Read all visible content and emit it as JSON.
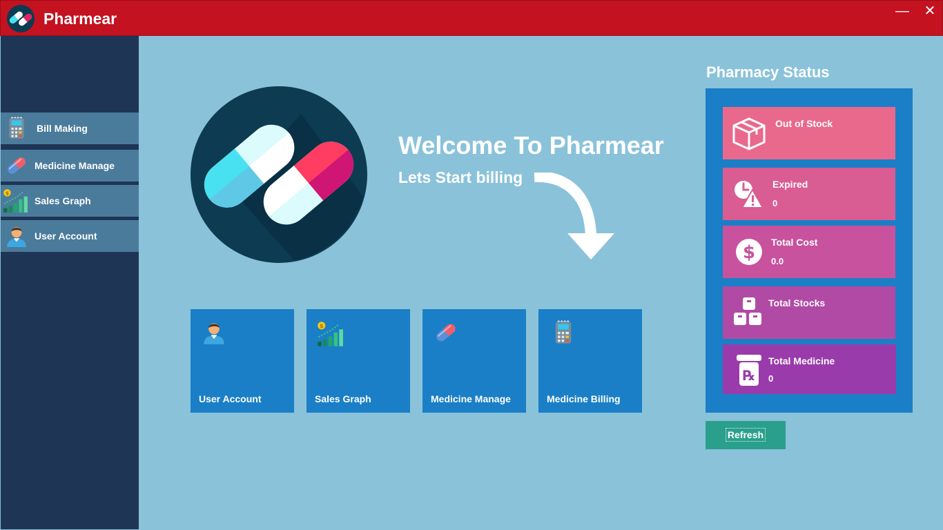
{
  "window": {
    "title": "Pharmear",
    "minimize_glyph": "—",
    "close_glyph": "✕"
  },
  "sidebar": {
    "items": [
      {
        "label": "Bill Making",
        "icon": "calculator-icon"
      },
      {
        "label": "Medicine Manage",
        "icon": "pill-icon"
      },
      {
        "label": "Sales Graph",
        "icon": "sales-graph-icon"
      },
      {
        "label": "User Account",
        "icon": "user-icon"
      }
    ]
  },
  "hero": {
    "title": "Welcome To Pharmear",
    "subtitle": "Lets Start billing"
  },
  "tiles": [
    {
      "label": "User Account",
      "icon": "user-icon"
    },
    {
      "label": "Sales Graph",
      "icon": "sales-graph-icon"
    },
    {
      "label": "Medicine Manage",
      "icon": "pill-icon"
    },
    {
      "label": "Medicine Billing",
      "icon": "calculator-icon"
    }
  ],
  "status": {
    "title": "Pharmacy Status",
    "cards": [
      {
        "title": "Out of Stock",
        "value": "",
        "icon": "box-icon",
        "color": "#e9698c"
      },
      {
        "title": "Expired",
        "value": "0",
        "icon": "expired-icon",
        "color": "#d95c92"
      },
      {
        "title": "Total Cost",
        "value": "0.0",
        "icon": "dollar-icon",
        "color": "#c8529d"
      },
      {
        "title": "Total Stocks",
        "value": "",
        "icon": "stock-boxes-icon",
        "color": "#b14aa5"
      },
      {
        "title": "Total Medicine",
        "value": "0",
        "icon": "prescription-icon",
        "color": "#9a3bab"
      }
    ],
    "refresh_label": "Refresh"
  },
  "colors": {
    "titlebar": "#c41220",
    "sidebar": "#1f3556",
    "sidebar_item": "#4a7b9b",
    "content_bg": "#8ac2da",
    "tile": "#1a7fc6",
    "refresh": "#2aa08c"
  }
}
